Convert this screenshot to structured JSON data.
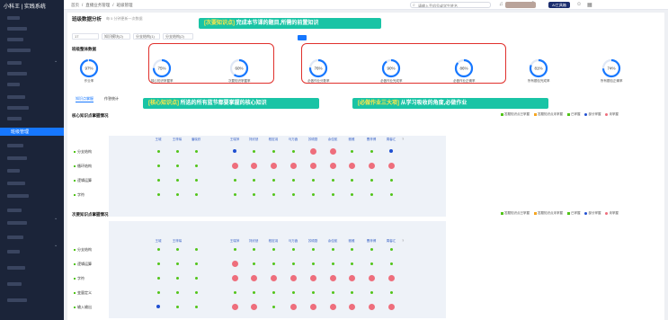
{
  "app": {
    "logo": "小科王 | 实践系统"
  },
  "sidebar": {
    "active_item": "班级管理"
  },
  "breadcrumb": [
    "首页",
    "/",
    "直播业务管理",
    "/",
    "班级管理"
  ],
  "search": {
    "placeholder": "请输入手机号或学生姓名"
  },
  "header": {
    "ai_button": "AI工具箱"
  },
  "page": {
    "title": "班级数据分析",
    "subtitle": "每 5 分钟更新一次数据",
    "filters": [
      "17",
      "知识模块(2)",
      "分支结构(1)",
      "分支结构(2)"
    ]
  },
  "overview": {
    "title": "班级整体数据",
    "gauges": [
      {
        "value": 97,
        "label": "作业率"
      },
      {
        "value": 75,
        "label": "核心知识掌握率"
      },
      {
        "value": 60,
        "label": "次要知识掌握率"
      },
      {
        "value": 76,
        "label": "必做作业分数率"
      },
      {
        "value": 90,
        "label": "必做作业完成率"
      },
      {
        "value": 86,
        "label": "必做作业正确率"
      },
      {
        "value": 81,
        "label": "所有题包完成率"
      },
      {
        "value": 74,
        "label": "所有题包正确率"
      }
    ]
  },
  "callouts": {
    "secondary_tag": "[次要知识点]",
    "secondary_text": "完成本节课的题目,所需的前置知识",
    "core_tag": "[核心知识点]",
    "core_text": "所选的所有蓝节都要掌握的核心知识",
    "homework_tag": "[必做作业三大项]",
    "homework_text": "从学习吸收的角度,必做作业"
  },
  "tabs": [
    "知识点掌握",
    "作答统计"
  ],
  "legend1": [
    "答题知识点已掌握",
    "答题知识点未掌握",
    "已掌握",
    "部分掌握",
    "未掌握"
  ],
  "legend2": [
    "答题知识点已掌握",
    "答题知识点未掌握",
    "已掌握",
    "部分掌握",
    "未掌握"
  ],
  "colors": {
    "green": "#52c41a",
    "orange": "#f5a623",
    "blue": "#1f4fd1",
    "red": "#ee6e7c",
    "accent": "#1677ff",
    "callout": "#19c4a5"
  },
  "core_section": {
    "title": "核心知识点掌握情况",
    "students": [
      "王城",
      "王梓琛",
      "潘晓欣",
      "",
      "王瑞萍",
      "刘欣然",
      "程宏羽",
      "马万鑫",
      "苏硕勋",
      "余佳航",
      "雅雅",
      "曹梓博",
      "周馨汇"
    ],
    "rows": [
      {
        "name": "分支结构",
        "cells": [
          "g",
          "g",
          "g",
          "",
          "b",
          "g",
          "g",
          "g",
          "r",
          "r",
          "g",
          "g",
          "b"
        ]
      },
      {
        "name": "循环结构",
        "cells": [
          "g",
          "g",
          "g",
          "",
          "r",
          "r",
          "r",
          "r",
          "r",
          "r",
          "r",
          "r",
          "r"
        ]
      },
      {
        "name": "逻辑运算",
        "cells": [
          "g",
          "g",
          "g",
          "",
          "g",
          "g",
          "g",
          "g",
          "g",
          "g",
          "g",
          "g",
          "g"
        ]
      },
      {
        "name": "字符",
        "cells": [
          "g",
          "g",
          "g",
          "",
          "g",
          "g",
          "g",
          "g",
          "g",
          "g",
          "g",
          "g",
          "g"
        ]
      }
    ]
  },
  "minor_section": {
    "title": "次要知识点掌握情况",
    "students": [
      "王城",
      "王梓琛",
      "",
      "",
      "王瑞萍",
      "刘欣然",
      "程宏羽",
      "马万鑫",
      "苏硕勋",
      "余佳航",
      "雅雅",
      "曹梓博",
      "周馨汇"
    ],
    "rows": [
      {
        "name": "分支结构",
        "cells": [
          "g",
          "g",
          "g",
          "",
          "g",
          "g",
          "g",
          "g",
          "g",
          "g",
          "g",
          "g",
          "g"
        ]
      },
      {
        "name": "逻辑运算",
        "cells": [
          "g",
          "g",
          "g",
          "",
          "r",
          "g",
          "g",
          "g",
          "g",
          "g",
          "g",
          "g",
          "g"
        ]
      },
      {
        "name": "字符",
        "cells": [
          "g",
          "g",
          "g",
          "",
          "r",
          "r",
          "r",
          "r",
          "r",
          "r",
          "r",
          "r",
          "r"
        ]
      },
      {
        "name": "变量定义",
        "cells": [
          "g",
          "g",
          "g",
          "",
          "g",
          "g",
          "g",
          "g",
          "g",
          "g",
          "g",
          "g",
          "g"
        ]
      },
      {
        "name": "输入输出",
        "cells": [
          "b",
          "g",
          "g",
          "",
          "r",
          "r",
          "g",
          "r",
          "r",
          "r",
          "r",
          "r",
          "r"
        ]
      }
    ]
  }
}
